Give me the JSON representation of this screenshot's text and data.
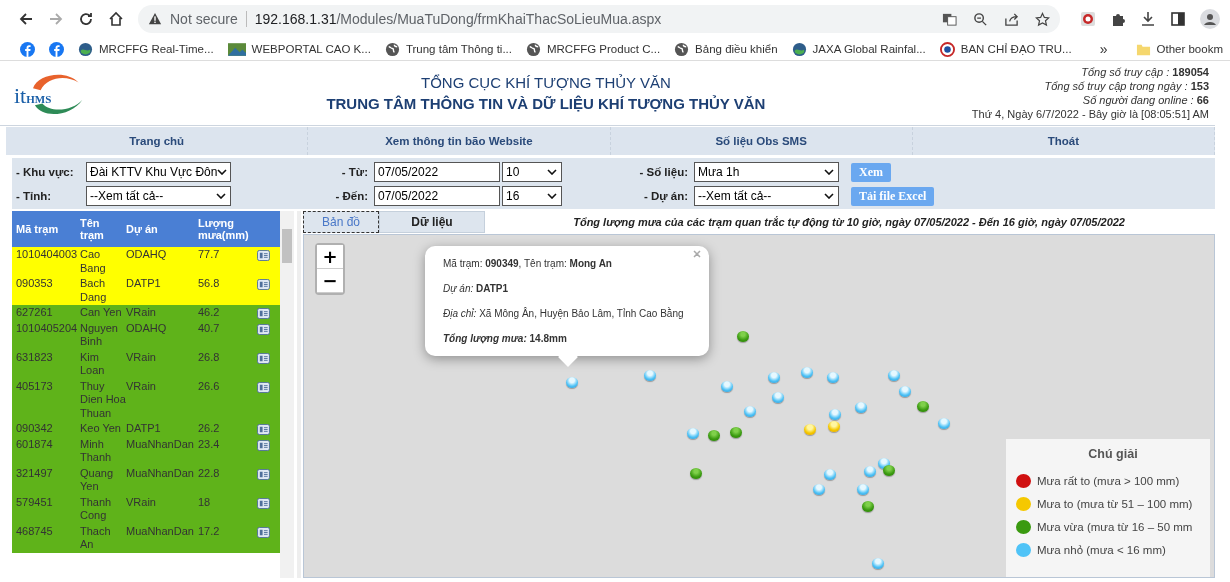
{
  "browser": {
    "nav": {
      "forward_disabled": true
    },
    "security": "Not secure",
    "url_host": "192.168.1.31",
    "url_path": "/Modules/MuaTuDong/frmKhaiThacSoLieuMua.aspx",
    "bookmarks": [
      {
        "kind": "facebook"
      },
      {
        "kind": "facebook"
      },
      {
        "kind": "globe-photo",
        "label": "MRCFFG Real-Time..."
      },
      {
        "kind": "image",
        "label": "WEBPORTAL CAO K..."
      },
      {
        "kind": "globe",
        "label": "Trung tâm Thông ti..."
      },
      {
        "kind": "globe",
        "label": "MRCFFG Product C..."
      },
      {
        "kind": "globe",
        "label": "Bảng điều khiển"
      },
      {
        "kind": "globe-photo",
        "label": "JAXA Global Rainfal..."
      },
      {
        "kind": "emblem",
        "label": "BAN CHỈ ĐẠO TRU..."
      }
    ],
    "more": "»",
    "other_bookmarks": "Other bookm"
  },
  "header": {
    "logo": {
      "text_1": "it",
      "text_2": "HMS"
    },
    "org": "TỔNG CỤC KHÍ TƯỢNG THỦY VĂN",
    "center": "TRUNG TÂM THÔNG TIN VÀ DỮ LIỆU KHÍ TƯỢNG THỦY VĂN",
    "stats": [
      "*Tổng số truy cập :* **189054**",
      "*Tổng số truy cập trong ngày :* **153**",
      "*Số người đang online :* **66**",
      "Thứ 4, Ngày 6/7/2022 - Bây giờ là [08:05:51] AM"
    ]
  },
  "nav": [
    "Trang chủ",
    "Xem thông tin bão Website",
    "Số liệu Obs SMS",
    "Thoát"
  ],
  "filters": {
    "region_label": "- Khu vực:",
    "region": "Đài KTTV Khu Vực Đôn",
    "province_label": "- Tỉnh:",
    "province": "--Xem tất cả--",
    "from_label": "- Từ:",
    "from_date": "07/05/2022",
    "from_hour": "10",
    "to_label": "- Đến:",
    "to_date": "07/05/2022",
    "to_hour": "16",
    "data_label": "- Số liệu:",
    "data": "Mưa 1h",
    "project_label": "- Dự án:",
    "project": "--Xem tất cả--",
    "view_button": "Xem",
    "excel_button": "Tải file Excel"
  },
  "table": {
    "columns": [
      "Mã trạm",
      "Tên trạm",
      "Dự án",
      "Lượng mưa(mm)"
    ],
    "rows": [
      {
        "code": "1010404003",
        "name": "Cao Bang",
        "project": "ODAHQ",
        "rain": "77.7",
        "color": "#ffff00"
      },
      {
        "code": "090353",
        "name": "Bach Dang",
        "project": "DATP1",
        "rain": "56.8",
        "color": "#ffff00"
      },
      {
        "code": "627261",
        "name": "Can Yen",
        "project": "VRain",
        "rain": "46.2",
        "color": "#5fb31a"
      },
      {
        "code": "1010405204",
        "name": "Nguyen Binh",
        "project": "ODAHQ",
        "rain": "40.7",
        "color": "#5fb31a"
      },
      {
        "code": "631823",
        "name": "Kim Loan",
        "project": "VRain",
        "rain": "26.8",
        "color": "#5fb31a"
      },
      {
        "code": "405173",
        "name": "Thuy Dien Hoa Thuan",
        "project": "VRain",
        "rain": "26.6",
        "color": "#5fb31a"
      },
      {
        "code": "090342",
        "name": "Keo Yen",
        "project": "DATP1",
        "rain": "26.2",
        "color": "#5fb31a"
      },
      {
        "code": "601874",
        "name": "Minh Thanh",
        "project": "MuaNhanDan",
        "rain": "23.4",
        "color": "#5fb31a"
      },
      {
        "code": "321497",
        "name": "Quang Yen",
        "project": "MuaNhanDan",
        "rain": "22.8",
        "color": "#5fb31a"
      },
      {
        "code": "579451",
        "name": "Thanh Cong",
        "project": "VRain",
        "rain": "18",
        "color": "#5fb31a"
      },
      {
        "code": "468745",
        "name": "Thach An",
        "project": "MuaNhanDan",
        "rain": "17.2",
        "color": "#5fb31a"
      }
    ]
  },
  "tabs": [
    {
      "label": "Bản đồ",
      "selected": true
    },
    {
      "label": "Dữ liệu",
      "selected": false
    }
  ],
  "caption": "Tổng lượng mưa của các trạm quan trắc tự động từ 10 giờ, ngày 07/05/2022 - Đến 16 giờ, ngày 07/05/2022",
  "map": {
    "zoom_in": "+",
    "zoom_out": "−",
    "popup": {
      "lines": [
        "Mã trạm: **090349**, Tên trạm: **Mong An**",
        "*Dự án:* **DATP1**",
        "*Địa chỉ:* Xã Mông Ân, Huyện Bảo Lâm, Tỉnh Cao Bằng"
      ],
      "total_label": "Tổng lượng mưa:",
      "total_value": "14.8mm"
    },
    "markers": [
      {
        "kind": "small"
      },
      {
        "kind": "small"
      },
      {
        "kind": "small"
      },
      {
        "kind": "small"
      },
      {
        "kind": "small"
      },
      {
        "kind": "small"
      },
      {
        "kind": "small"
      },
      {
        "kind": "small"
      },
      {
        "kind": "small"
      },
      {
        "kind": "small"
      },
      {
        "kind": "small"
      },
      {
        "kind": "small"
      },
      {
        "kind": "small"
      },
      {
        "kind": "small"
      },
      {
        "kind": "small"
      },
      {
        "kind": "small"
      },
      {
        "kind": "small"
      },
      {
        "kind": "small"
      },
      {
        "kind": "small"
      },
      {
        "kind": "small"
      },
      {
        "kind": "medium"
      },
      {
        "kind": "medium"
      },
      {
        "kind": "medium"
      },
      {
        "kind": "medium"
      },
      {
        "kind": "medium"
      },
      {
        "kind": "medium"
      },
      {
        "kind": "medium"
      },
      {
        "kind": "heavy"
      },
      {
        "kind": "heavy"
      }
    ],
    "legend": {
      "title": "Chú giải",
      "items": [
        {
          "label": "Mưa rất to (mưa > 100 mm)",
          "color": "#d01010"
        },
        {
          "label": "Mưa to (mưa từ 51 – 100 mm)",
          "color": "#f5c800"
        },
        {
          "label": "Mưa vừa (mưa từ 16 – 50 mm",
          "color": "#3a9a10"
        },
        {
          "label": "Mưa nhỏ (mưa < 16 mm)",
          "color": "#4fc3f7"
        }
      ]
    }
  }
}
